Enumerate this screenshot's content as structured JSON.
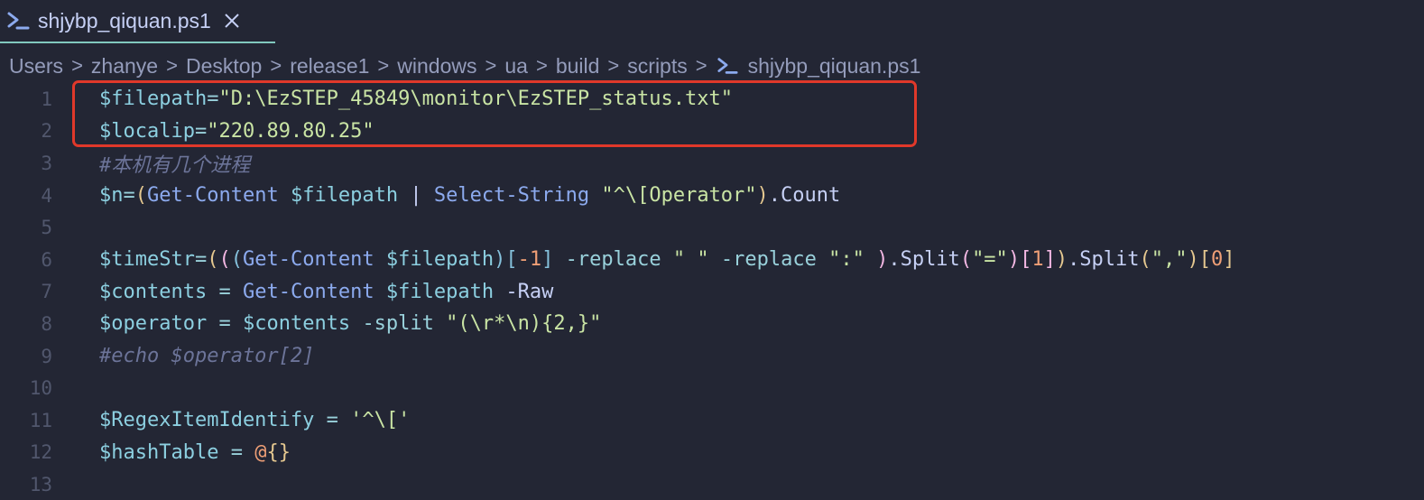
{
  "tab": {
    "icon": "powershell-icon",
    "title": "shjybp_qiquan.ps1",
    "close_icon": "close-icon"
  },
  "breadcrumb": {
    "items": [
      "Users",
      "zhanye",
      "Desktop",
      "release1",
      "windows",
      "ua",
      "build",
      "scripts"
    ],
    "separator": ">",
    "file_icon": "powershell-icon",
    "file": "shjybp_qiquan.ps1"
  },
  "colors": {
    "background": "#232634",
    "accent": "#81c8be",
    "highlight_box": "#e0382a"
  },
  "editor": {
    "line_numbers": [
      "1",
      "2",
      "3",
      "4",
      "5",
      "6",
      "7",
      "8",
      "9",
      "10",
      "11",
      "12",
      "13"
    ],
    "lines": [
      {
        "tokens": [
          {
            "t": "$filepath",
            "k": "v"
          },
          {
            "t": "=",
            "k": "o"
          },
          {
            "t": "\"D:\\EzSTEP_45849\\monitor\\EzSTEP_status.txt\"",
            "k": "s"
          }
        ]
      },
      {
        "tokens": [
          {
            "t": "$localip",
            "k": "v"
          },
          {
            "t": "=",
            "k": "o"
          },
          {
            "t": "\"220.89.80.25\"",
            "k": "s"
          }
        ]
      },
      {
        "tokens": [
          {
            "t": "#本机有几个进程",
            "k": "c"
          }
        ]
      },
      {
        "tokens": [
          {
            "t": "$n",
            "k": "v"
          },
          {
            "t": "=",
            "k": "o"
          },
          {
            "t": "(",
            "k": "b1"
          },
          {
            "t": "Get-Content",
            "k": "f"
          },
          {
            "t": " ",
            "k": "p"
          },
          {
            "t": "$filepath",
            "k": "v"
          },
          {
            "t": " | ",
            "k": "p"
          },
          {
            "t": "Select-String",
            "k": "f"
          },
          {
            "t": " ",
            "k": "p"
          },
          {
            "t": "\"^\\[Operator\"",
            "k": "s"
          },
          {
            "t": ")",
            "k": "b1"
          },
          {
            "t": ".Count",
            "k": "p"
          }
        ]
      },
      {
        "tokens": []
      },
      {
        "tokens": [
          {
            "t": "$timeStr",
            "k": "v"
          },
          {
            "t": "=",
            "k": "o"
          },
          {
            "t": "(",
            "k": "b1"
          },
          {
            "t": "(",
            "k": "b2"
          },
          {
            "t": "(",
            "k": "b3"
          },
          {
            "t": "Get-Content",
            "k": "f"
          },
          {
            "t": " ",
            "k": "p"
          },
          {
            "t": "$filepath",
            "k": "v"
          },
          {
            "t": ")",
            "k": "b3"
          },
          {
            "t": "[",
            "k": "b3"
          },
          {
            "t": "-1",
            "k": "n"
          },
          {
            "t": "]",
            "k": "b3"
          },
          {
            "t": " ",
            "k": "p"
          },
          {
            "t": "-replace",
            "k": "o"
          },
          {
            "t": " ",
            "k": "p"
          },
          {
            "t": "\" \"",
            "k": "s"
          },
          {
            "t": " ",
            "k": "p"
          },
          {
            "t": "-replace",
            "k": "o"
          },
          {
            "t": " ",
            "k": "p"
          },
          {
            "t": "\":\"",
            "k": "s"
          },
          {
            "t": " ",
            "k": "p"
          },
          {
            "t": ")",
            "k": "b2"
          },
          {
            "t": ".Split",
            "k": "p"
          },
          {
            "t": "(",
            "k": "b2"
          },
          {
            "t": "\"=\"",
            "k": "s"
          },
          {
            "t": ")",
            "k": "b2"
          },
          {
            "t": "[",
            "k": "b2"
          },
          {
            "t": "1",
            "k": "n"
          },
          {
            "t": "]",
            "k": "b2"
          },
          {
            "t": ")",
            "k": "b1"
          },
          {
            "t": ".Split",
            "k": "p"
          },
          {
            "t": "(",
            "k": "b1"
          },
          {
            "t": "\",\"",
            "k": "s"
          },
          {
            "t": ")",
            "k": "b1"
          },
          {
            "t": "[",
            "k": "b1"
          },
          {
            "t": "0",
            "k": "n"
          },
          {
            "t": "]",
            "k": "b1"
          }
        ]
      },
      {
        "tokens": [
          {
            "t": "$contents",
            "k": "v"
          },
          {
            "t": " = ",
            "k": "o"
          },
          {
            "t": "Get-Content",
            "k": "f"
          },
          {
            "t": " ",
            "k": "p"
          },
          {
            "t": "$filepath",
            "k": "v"
          },
          {
            "t": " ",
            "k": "p"
          },
          {
            "t": "-Raw",
            "k": "p"
          }
        ]
      },
      {
        "tokens": [
          {
            "t": "$operator",
            "k": "v"
          },
          {
            "t": " = ",
            "k": "o"
          },
          {
            "t": "$contents",
            "k": "v"
          },
          {
            "t": " ",
            "k": "p"
          },
          {
            "t": "-split",
            "k": "o"
          },
          {
            "t": " ",
            "k": "p"
          },
          {
            "t": "\"(\\r*\\n){2,}\"",
            "k": "s"
          }
        ]
      },
      {
        "tokens": [
          {
            "t": "#echo $operator[2]",
            "k": "c"
          }
        ]
      },
      {
        "tokens": []
      },
      {
        "tokens": [
          {
            "t": "$RegexItemIdentify",
            "k": "v"
          },
          {
            "t": " = ",
            "k": "o"
          },
          {
            "t": "'^\\['",
            "k": "s"
          }
        ]
      },
      {
        "tokens": [
          {
            "t": "$hashTable",
            "k": "v"
          },
          {
            "t": " = ",
            "k": "o"
          },
          {
            "t": "@",
            "k": "n"
          },
          {
            "t": "{}",
            "k": "b1"
          }
        ]
      },
      {
        "tokens": []
      }
    ]
  }
}
